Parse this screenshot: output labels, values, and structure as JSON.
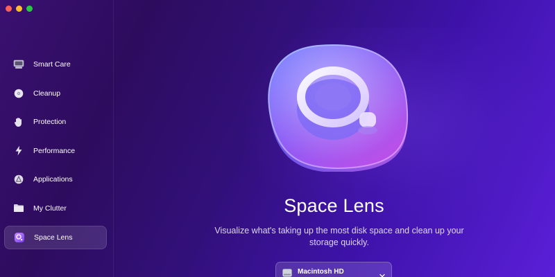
{
  "window": {
    "controls": [
      "close",
      "minimize",
      "zoom"
    ]
  },
  "sidebar": {
    "items": [
      {
        "label": "Smart Care",
        "icon": "monitor-icon",
        "active": false
      },
      {
        "label": "Cleanup",
        "icon": "disc-icon",
        "active": false
      },
      {
        "label": "Protection",
        "icon": "hand-icon",
        "active": false
      },
      {
        "label": "Performance",
        "icon": "lightning-icon",
        "active": false
      },
      {
        "label": "Applications",
        "icon": "apps-icon",
        "active": false
      },
      {
        "label": "My Clutter",
        "icon": "folder-icon",
        "active": false
      },
      {
        "label": "Space Lens",
        "icon": "lens-icon",
        "active": true
      }
    ]
  },
  "main": {
    "title": "Space Lens",
    "subtitle": "Visualize what's taking up the most disk space and clean up your storage quickly.",
    "disk_select": {
      "value": "Macintosh HD",
      "icon": "hard-drive-icon"
    }
  },
  "colors": {
    "accent": "#7b3fe4",
    "background_start": "#2d0c5e",
    "background_end": "#5a1fd8"
  }
}
